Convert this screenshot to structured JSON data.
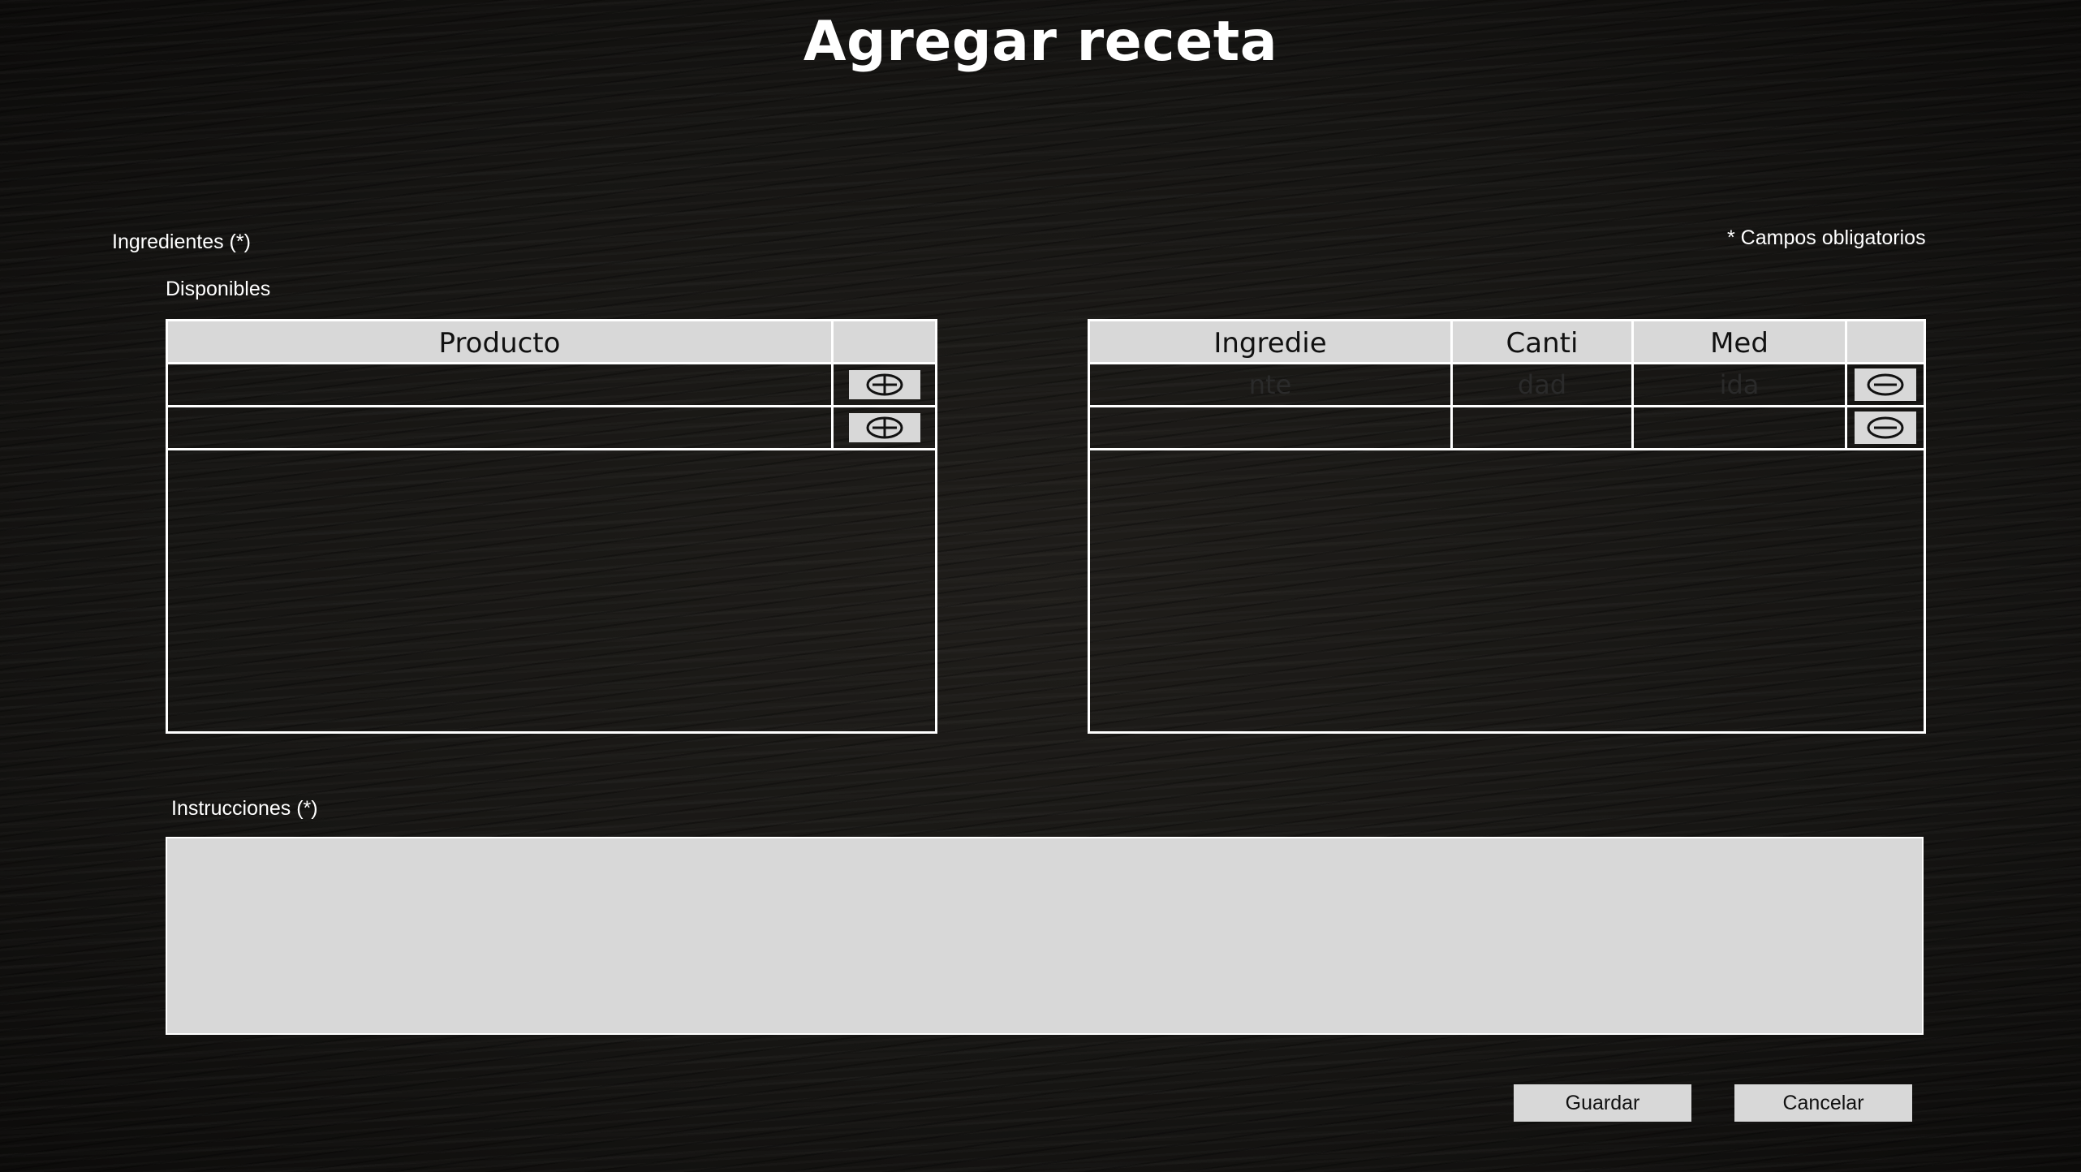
{
  "page": {
    "title": "Agregar receta"
  },
  "form": {
    "ingredients_label": "Ingredientes (*)",
    "required_note": "* Campos obligatorios",
    "available_label": "Disponibles",
    "instructions_label": "Instrucciones (*)",
    "instructions_value": ""
  },
  "available_table": {
    "headers": [
      "Producto",
      ""
    ],
    "rows": [
      {
        "producto": "",
        "action_icon": "plus-circle-icon"
      },
      {
        "producto": "",
        "action_icon": "plus-circle-icon"
      }
    ]
  },
  "ingredients_table": {
    "headers": [
      "Ingredie",
      "Canti",
      "Med",
      ""
    ],
    "rows": [
      {
        "ingrediente": "nte",
        "cantidad": "dad",
        "medida": "ida",
        "action_icon": "minus-circle-icon"
      },
      {
        "ingrediente": "",
        "cantidad": "",
        "medida": "",
        "action_icon": "minus-circle-icon"
      }
    ]
  },
  "actions": {
    "save_label": "Guardar",
    "cancel_label": "Cancelar"
  },
  "colors": {
    "background": "#161513",
    "panel": "#d8d8d8",
    "border": "#ffffff",
    "text": "#ffffff"
  }
}
